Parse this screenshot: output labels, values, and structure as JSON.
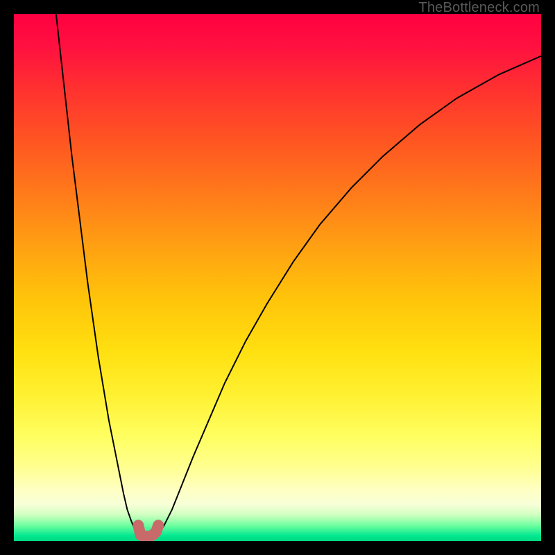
{
  "watermark": "TheBottleneck.com",
  "chart_data": {
    "type": "line",
    "title": "",
    "xlabel": "",
    "ylabel": "",
    "xlim": [
      0,
      100
    ],
    "ylim": [
      0,
      100
    ],
    "grid": false,
    "legend": false,
    "series": [
      {
        "name": "left-curve",
        "x": [
          8,
          9,
          10,
          11,
          12,
          13,
          14,
          15,
          16,
          17,
          18,
          19,
          20,
          20.8,
          21.5,
          22.2,
          22.8,
          23.2,
          23.6
        ],
        "y": [
          100,
          91,
          82,
          73,
          65,
          57,
          49,
          42,
          35,
          29,
          23,
          18,
          13,
          9,
          6,
          4,
          2.5,
          1.5,
          1
        ]
      },
      {
        "name": "trough",
        "x": [
          23.6,
          24.0,
          24.6,
          25.2,
          25.8,
          26.4,
          27.0,
          27.4
        ],
        "y": [
          1,
          0.5,
          0.3,
          0.3,
          0.3,
          0.5,
          0.8,
          1.2
        ]
      },
      {
        "name": "right-curve",
        "x": [
          27.4,
          28.5,
          30,
          32,
          34,
          37,
          40,
          44,
          48,
          53,
          58,
          64,
          70,
          77,
          84,
          92,
          100
        ],
        "y": [
          1.2,
          3,
          6,
          11,
          16,
          23,
          30,
          38,
          45,
          53,
          60,
          67,
          73,
          79,
          84,
          88.5,
          92
        ]
      }
    ],
    "highlight": {
      "name": "trough-marker",
      "color": "#c96a6a",
      "x": [
        23.6,
        24.0,
        24.6,
        25.2,
        25.8,
        26.4,
        27.0,
        27.4
      ],
      "y": [
        3.0,
        1.2,
        0.9,
        0.9,
        0.9,
        1.2,
        1.8,
        3.0
      ]
    },
    "gradient_stops": [
      {
        "pos": 0,
        "color": "#ff0040"
      },
      {
        "pos": 50,
        "color": "#ffc000"
      },
      {
        "pos": 80,
        "color": "#ffff60"
      },
      {
        "pos": 100,
        "color": "#00d880"
      }
    ]
  }
}
